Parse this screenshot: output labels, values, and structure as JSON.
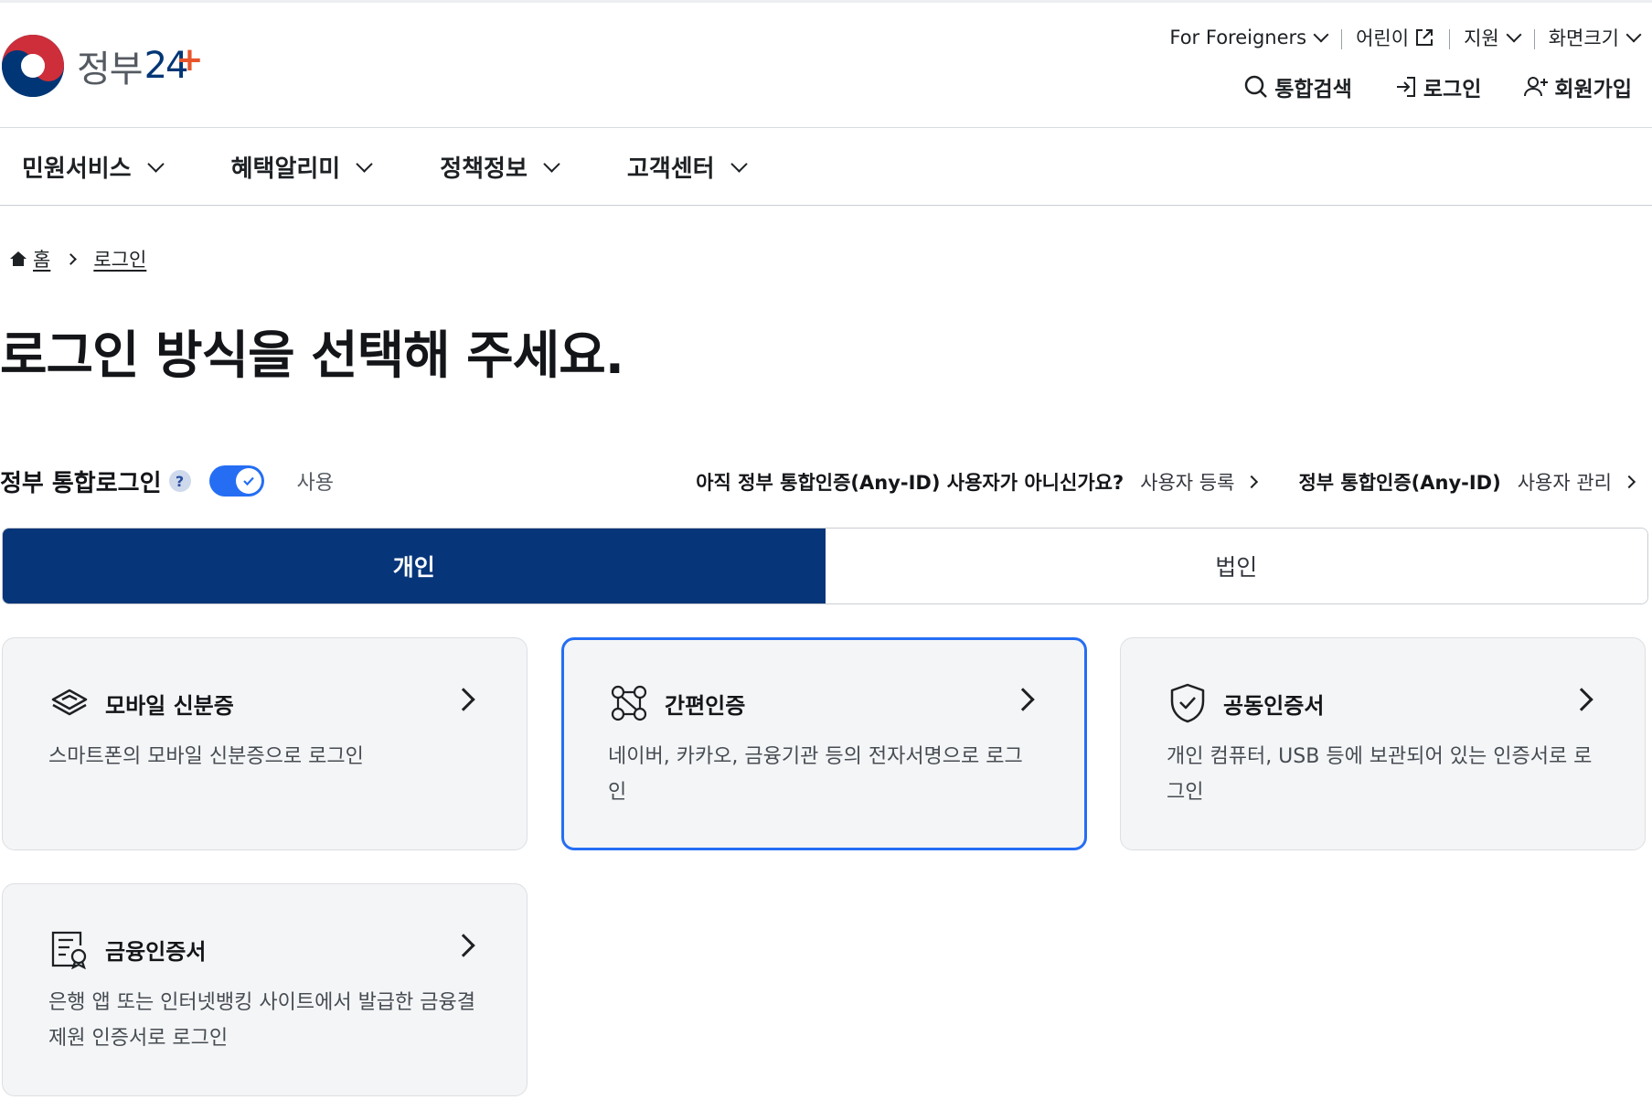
{
  "header": {
    "logo_text": "정부",
    "logo_num": "24",
    "logo_plus": "+",
    "util_links": [
      {
        "label": "For Foreigners",
        "icon": "chevron-down-icon"
      },
      {
        "label": "어린이",
        "icon": "external-link-icon"
      },
      {
        "label": "지원",
        "icon": "chevron-down-icon"
      },
      {
        "label": "화면크기",
        "icon": "chevron-down-icon"
      }
    ],
    "actions": {
      "search": "통합검색",
      "login": "로그인",
      "signup": "회원가입"
    }
  },
  "nav": {
    "items": [
      "민원서비스",
      "혜택알리미",
      "정책정보",
      "고객센터"
    ]
  },
  "breadcrumb": {
    "home": "홈",
    "current": "로그인"
  },
  "page_title": "로그인 방식을 선택해 주세요.",
  "integrated_login": {
    "label": "정부 통합로그인",
    "help": "?",
    "switch_on": true,
    "switch_text": "사용",
    "question": "아직 정부 통합인증(Any-ID) 사용자가 아니신가요?",
    "register_link": "사용자 등록",
    "anyid_label": "정부 통합인증(Any-ID)",
    "manage_link": "사용자 관리"
  },
  "tabs": {
    "personal": "개인",
    "corporate": "법인",
    "active": "개인"
  },
  "cards": [
    {
      "title": "모바일 신분증",
      "desc": "스마트폰의 모바일 신분증으로 로그인",
      "icon": "mobile-id-icon",
      "selected": false
    },
    {
      "title": "간편인증",
      "desc": "네이버, 카카오, 금융기관 등의 전자서명으로 로그인",
      "icon": "simple-auth-icon",
      "selected": true
    },
    {
      "title": "공동인증서",
      "desc": "개인 컴퓨터, USB 등에 보관되어 있는 인증서로 로그인",
      "icon": "shield-check-icon",
      "selected": false
    },
    {
      "title": "금융인증서",
      "desc": "은행 앱 또는 인터넷뱅킹 사이트에서 발급한 금융결제원 인증서로 로그인",
      "icon": "certificate-icon",
      "selected": false
    }
  ],
  "colors": {
    "primary_navy": "#063579",
    "accent_blue": "#256ef4",
    "logo_orange": "#e8552b"
  }
}
